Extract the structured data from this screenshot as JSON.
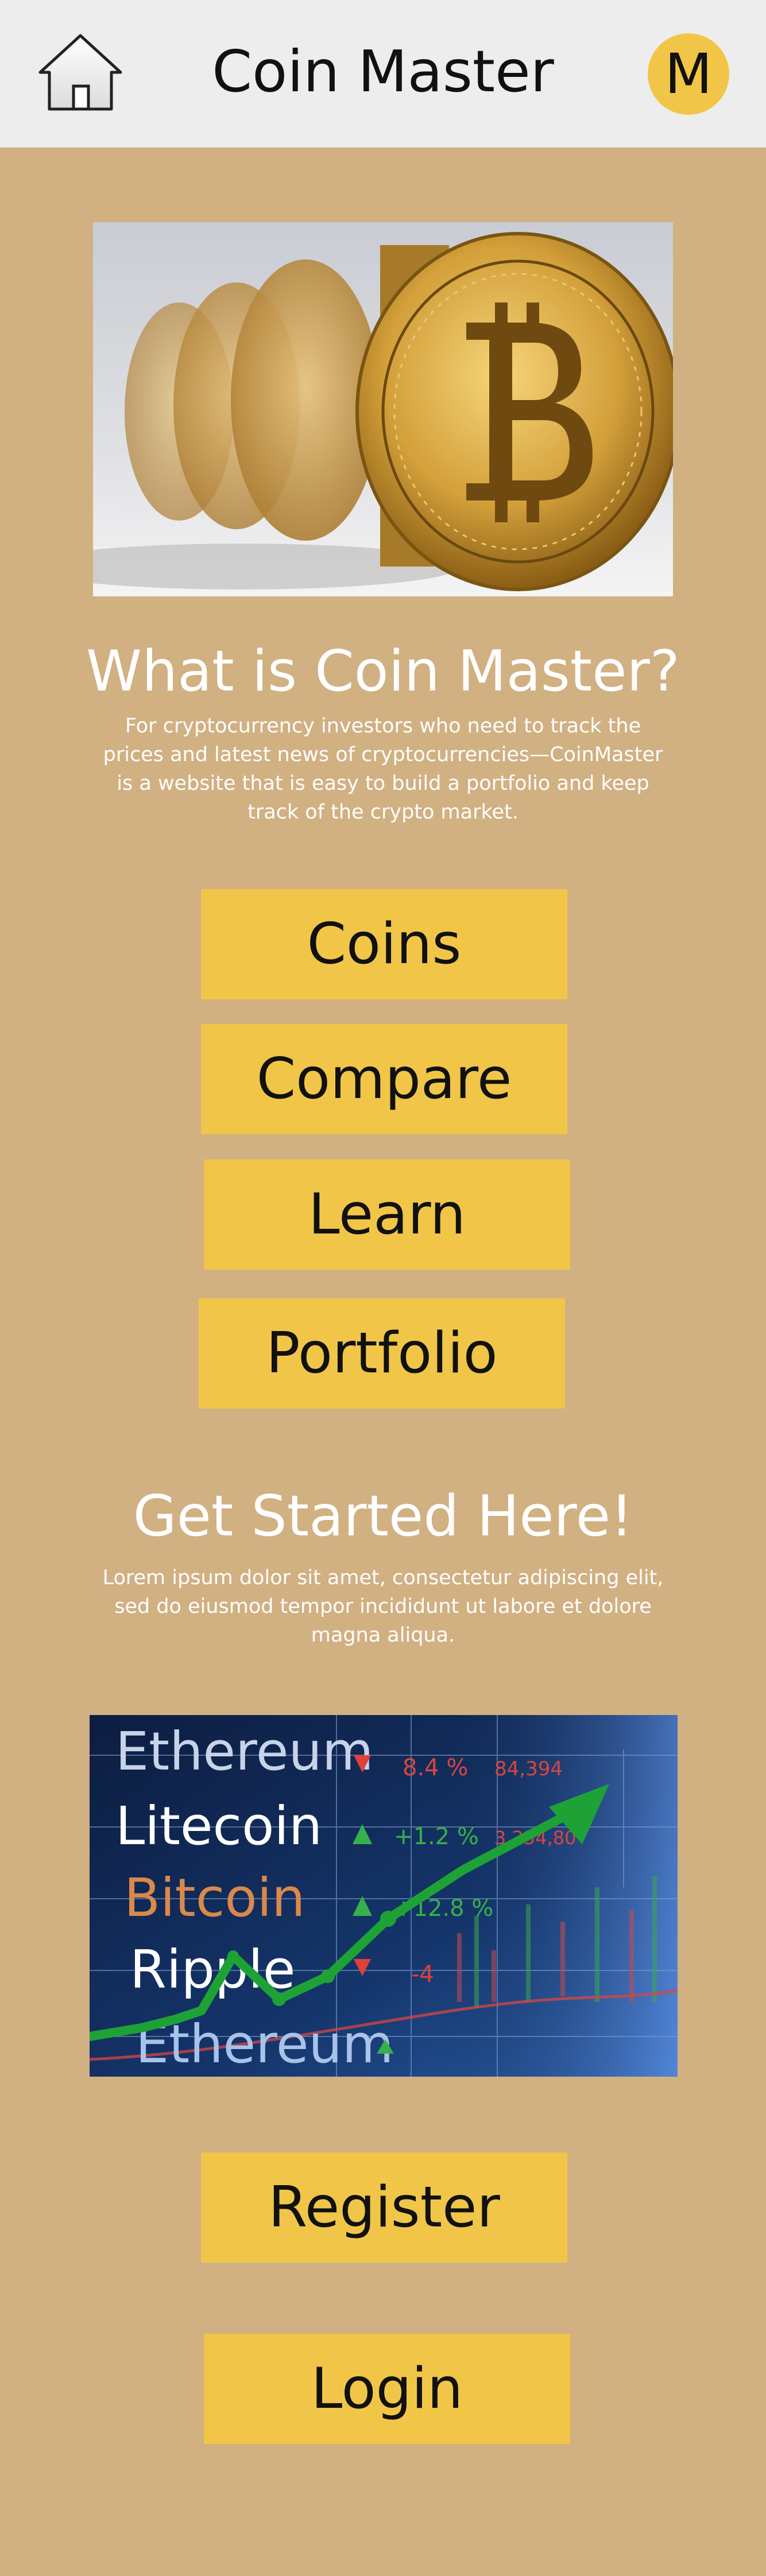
{
  "header": {
    "title": "Coin Master",
    "avatar_letter": "M",
    "home_icon": "home-icon"
  },
  "hero": {
    "image": "bitcoin-coin-image"
  },
  "about": {
    "heading": "What is Coin Master?",
    "text": "For cryptocurrency investors who need to track the prices and latest news of cryptocurrencies—CoinMaster is a website that is easy to build a portfolio and keep track of the crypto market."
  },
  "nav": {
    "coins": "Coins",
    "compare": "Compare",
    "learn": "Learn",
    "portfolio": "Portfolio"
  },
  "get_started": {
    "heading": "Get Started Here!",
    "text": "Lorem ipsum dolor sit amet, consectetur adipiscing elit, sed do eiusmod tempor incididunt ut labore et dolore magna aliqua."
  },
  "market_image": {
    "labels": [
      "Ethereum",
      "Litecoin",
      "Bitcoin",
      "Ripple",
      "Ethereum"
    ],
    "changes": [
      "8.4 %",
      "+1.2 %",
      "+12.8 %",
      "-4",
      ""
    ],
    "values": [
      "84,394",
      "3,254,80",
      "",
      "",
      ""
    ]
  },
  "auth": {
    "register": "Register",
    "login": "Login"
  },
  "colors": {
    "background": "#d1b082",
    "topbar": "#ededed",
    "accent": "#f1c648"
  }
}
